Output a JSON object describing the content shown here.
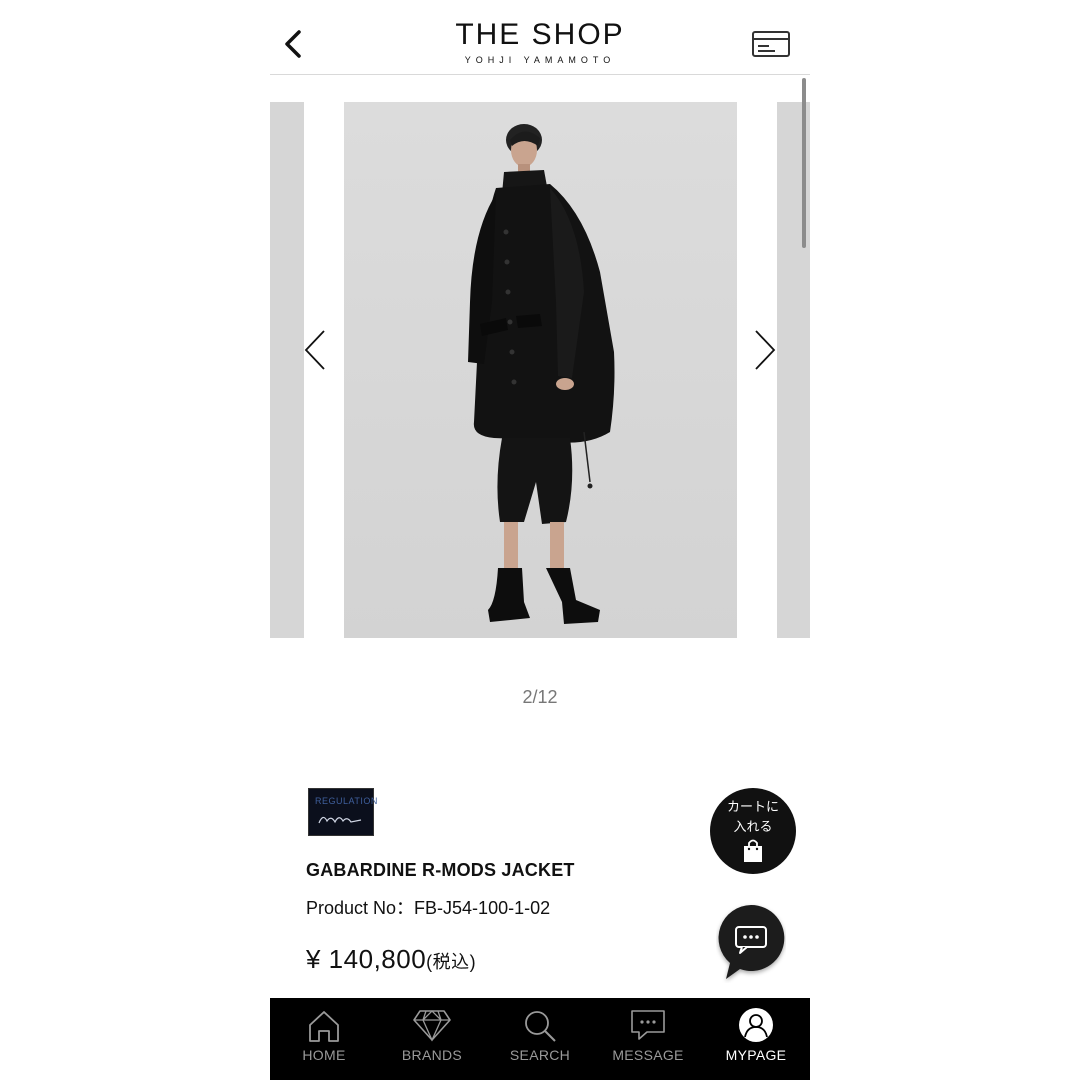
{
  "header": {
    "back_icon": "chevron-left-icon",
    "title": "THE SHOP",
    "subtitle": "YOHJI YAMAMOTO",
    "card_icon": "credit-card-icon"
  },
  "carousel": {
    "counter": "2/12",
    "prev_icon": "chevron-left-icon",
    "next_icon": "chevron-right-icon"
  },
  "product": {
    "brand_logo_text": "REGULATION",
    "name": "GABARDINE R-MODS JACKET",
    "product_no": "Product No：FB-J54-100-1-02",
    "price": "¥ 140,800",
    "price_tax": "(税込)"
  },
  "actions": {
    "add_to_cart_line1": "カートに",
    "add_to_cart_line2": "入れる",
    "cart_icon": "shopping-bag-icon",
    "chat_icon": "chat-bubble-icon"
  },
  "bottom_nav": {
    "home": "HOME",
    "brands": "BRANDS",
    "search": "SEARCH",
    "message": "MESSAGE",
    "mypage": "MYPAGE",
    "active": "MYPAGE"
  },
  "colors": {
    "nav_background": "#000000",
    "nav_inactive": "#9a9a9a",
    "nav_active": "#ffffff",
    "button_dark": "#111111"
  }
}
